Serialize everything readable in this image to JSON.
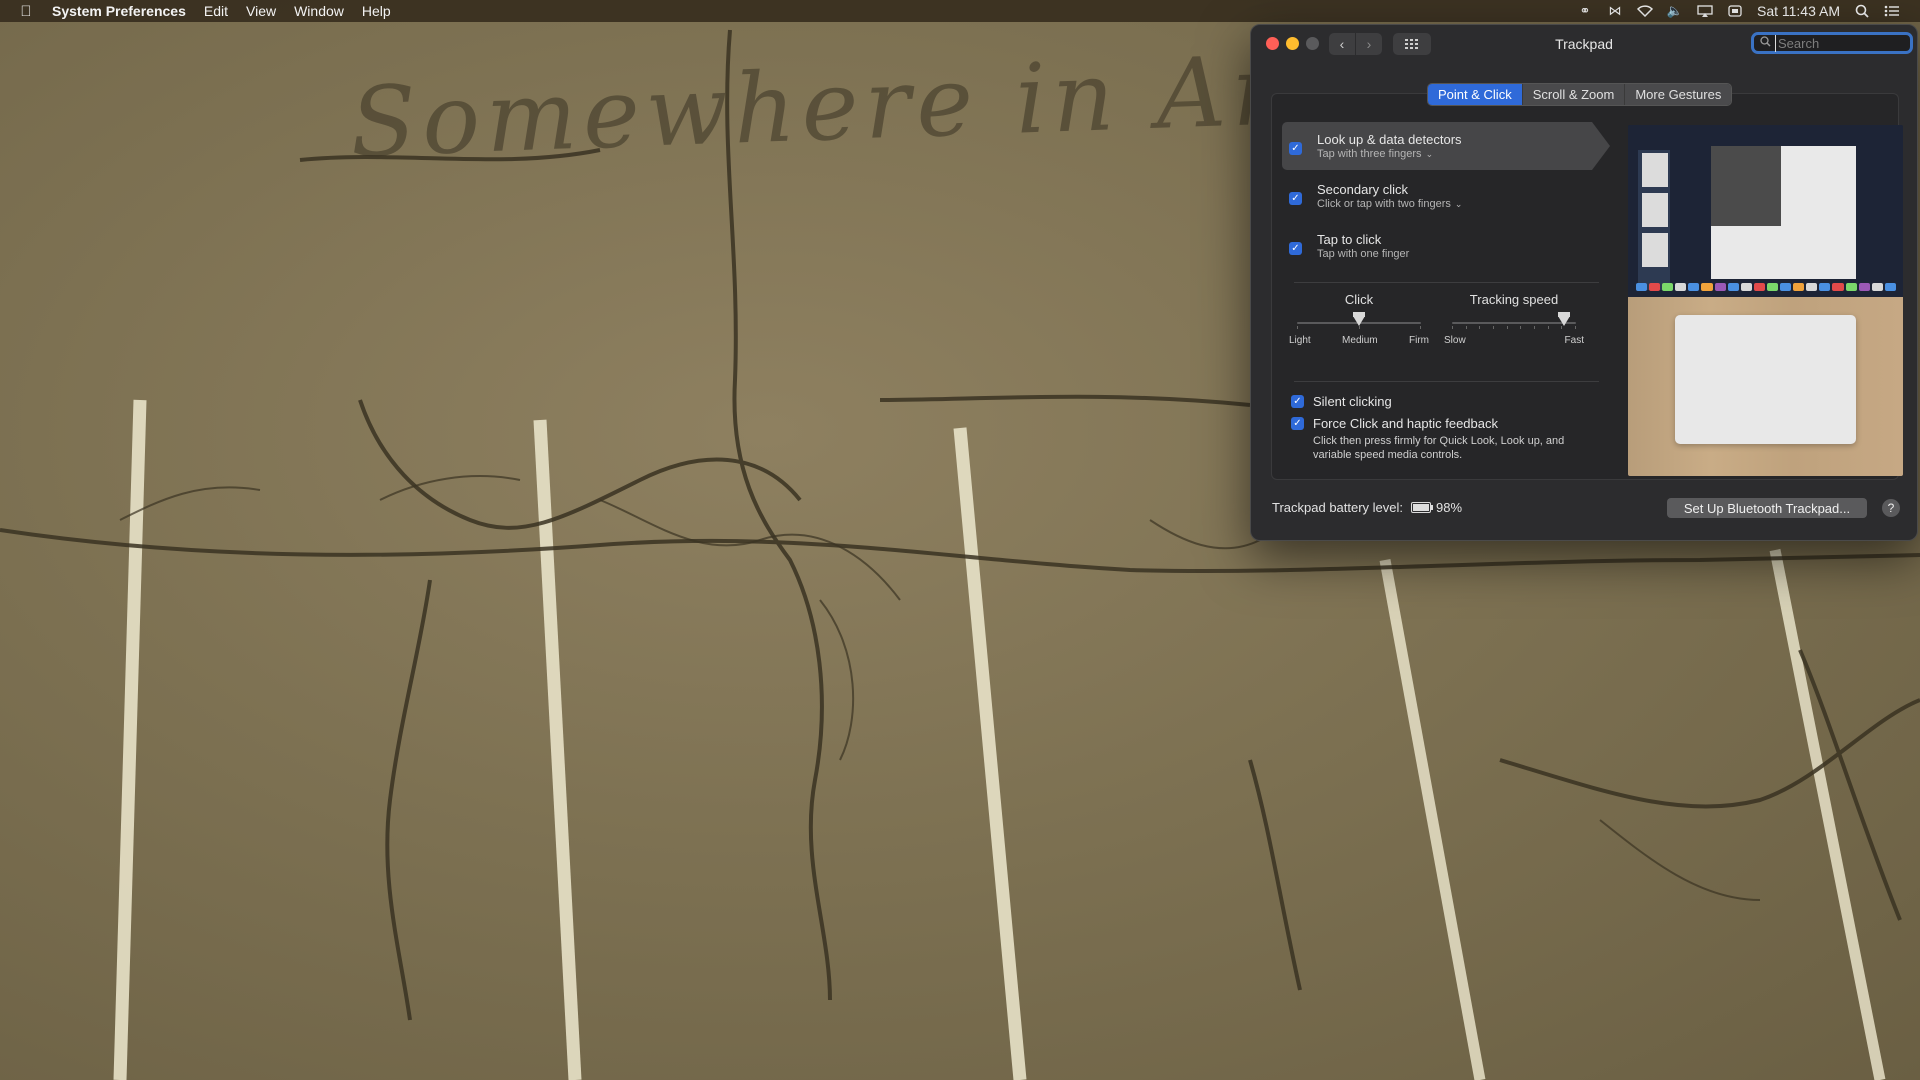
{
  "menubar": {
    "apple_icon": "apple-icon",
    "app_name": "System Preferences",
    "menus": [
      "Edit",
      "View",
      "Window",
      "Help"
    ],
    "status_icons": [
      "headphones-icon",
      "bluetooth-icon",
      "wifi-icon",
      "volume-icon",
      "airplay-icon",
      "input-source-icon"
    ],
    "clock": "Sat 11:43 AM"
  },
  "wallpaper": {
    "text": "Somewhere in America"
  },
  "window": {
    "title": "Trackpad",
    "search_placeholder": "Search",
    "tabs": [
      "Point & Click",
      "Scroll & Zoom",
      "More Gestures"
    ],
    "active_tab": "Point & Click",
    "options": [
      {
        "title": "Look up & data detectors",
        "subtitle": "Tap with three fingers",
        "checked": true,
        "has_dropdown": true
      },
      {
        "title": "Secondary click",
        "subtitle": "Click or tap with two fingers",
        "checked": true,
        "has_dropdown": true
      },
      {
        "title": "Tap to click",
        "subtitle": "Tap with one finger",
        "checked": true,
        "has_dropdown": false
      }
    ],
    "click_slider": {
      "title": "Click",
      "labels": [
        "Light",
        "Medium",
        "Firm"
      ],
      "value": 0.5
    },
    "tracking_slider": {
      "title": "Tracking speed",
      "labels": [
        "Slow",
        "Fast"
      ],
      "value": 0.9
    },
    "silent_clicking": {
      "label": "Silent clicking",
      "checked": true
    },
    "force_click": {
      "label": "Force Click and haptic feedback",
      "description": "Click then press firmly for Quick Look, Look up, and variable speed media controls.",
      "checked": true
    },
    "battery": {
      "label": "Trackpad battery level:",
      "value": "98%",
      "level": 0.98
    },
    "bluetooth_button": "Set Up Bluetooth Trackpad...",
    "help_label": "?"
  },
  "colors": {
    "accent": "#2f6ad9",
    "window_bg": "#2c2c2e"
  }
}
